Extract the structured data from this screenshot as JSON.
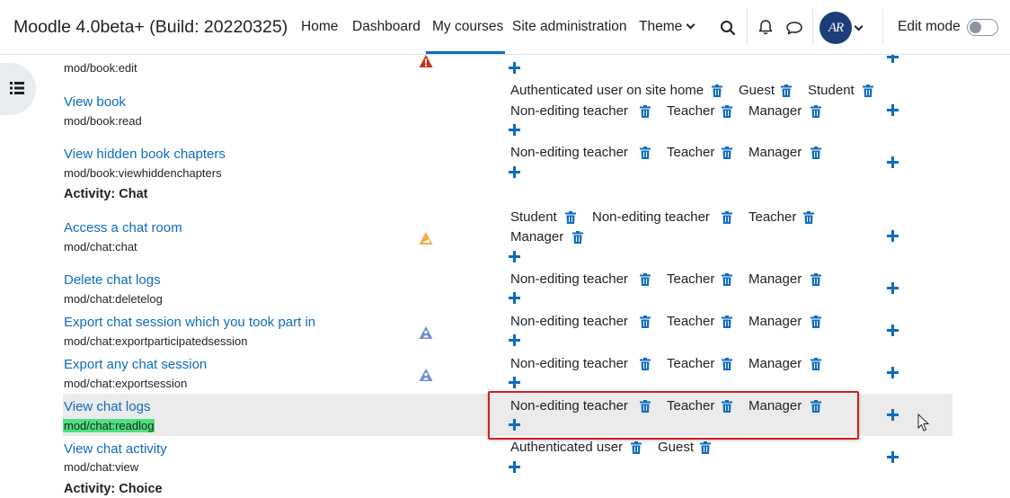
{
  "navbar": {
    "brand": "Moodle 4.0beta+ (Build: 20220325)",
    "items": [
      {
        "label": "Home"
      },
      {
        "label": "Dashboard"
      },
      {
        "label": "My courses",
        "active": true
      },
      {
        "label": "Site administration"
      },
      {
        "label": "Theme"
      }
    ],
    "avatar_initials": "AR",
    "edit_mode_label": "Edit mode",
    "edit_mode_on": false,
    "accent_color": "#0f6cbf"
  },
  "sections": [
    {
      "label": "Activity: Chat"
    },
    {
      "label": "Activity: Choice"
    }
  ],
  "capabilities": [
    {
      "name": "",
      "code": "mod/book:edit",
      "risk": "danger",
      "roles": []
    },
    {
      "name": "View book",
      "code": "mod/book:read",
      "risk": "",
      "roles": [
        "Authenticated user on site home",
        "Guest",
        "Student",
        "Non-editing teacher",
        "Teacher",
        "Manager"
      ]
    },
    {
      "name": "View hidden book chapters",
      "code": "mod/book:viewhiddenchapters",
      "risk": "",
      "roles": [
        "Non-editing teacher",
        "Teacher",
        "Manager"
      ]
    },
    {
      "name": "Access a chat room",
      "code": "mod/chat:chat",
      "risk": "spam",
      "roles": [
        "Student",
        "Non-editing teacher",
        "Teacher",
        "Manager"
      ]
    },
    {
      "name": "Delete chat logs",
      "code": "mod/chat:deletelog",
      "risk": "",
      "roles": [
        "Non-editing teacher",
        "Teacher",
        "Manager"
      ]
    },
    {
      "name": "Export chat session which you took part in",
      "code": "mod/chat:exportparticipatedsession",
      "risk": "personal",
      "roles": [
        "Non-editing teacher",
        "Teacher",
        "Manager"
      ]
    },
    {
      "name": "Export any chat session",
      "code": "mod/chat:exportsession",
      "risk": "personal",
      "roles": [
        "Non-editing teacher",
        "Teacher",
        "Manager"
      ]
    },
    {
      "name": "View chat logs",
      "code": "mod/chat:readlog",
      "risk": "",
      "highlighted": true,
      "roles": [
        "Non-editing teacher",
        "Teacher",
        "Manager"
      ]
    },
    {
      "name": "View chat activity",
      "code": "mod/chat:view",
      "risk": "",
      "roles": [
        "Authenticated user",
        "Guest"
      ]
    }
  ]
}
